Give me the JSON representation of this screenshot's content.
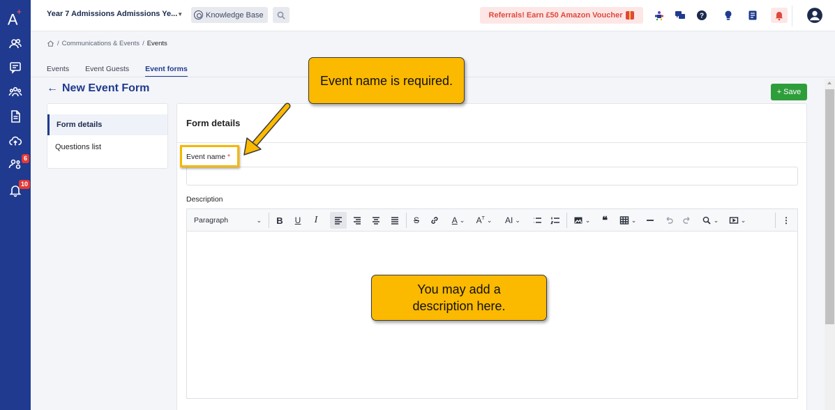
{
  "app": {
    "logo_text": "A",
    "logo_mark": "+"
  },
  "rail": {
    "items": [
      {
        "icon": "people-icon"
      },
      {
        "icon": "chat-icon"
      },
      {
        "icon": "group-icon"
      },
      {
        "icon": "document-icon"
      },
      {
        "icon": "cloud-upload-icon"
      },
      {
        "icon": "user-settings-icon",
        "badge": "6"
      },
      {
        "icon": "bell-icon",
        "badge": "10"
      }
    ]
  },
  "topbar": {
    "school_name": "Year 7 Admissions Admissions Ye...",
    "knowledge_base": "Knowledge Base",
    "referral": "Referrals! Earn £50 Amazon Voucher",
    "icons": [
      "community-icon",
      "messages-icon",
      "help-icon",
      "lightbulb-icon",
      "notes-icon",
      "bell-alert-icon",
      "user-avatar-icon"
    ]
  },
  "breadcrumb": {
    "items": [
      "Communications & Events",
      "Events"
    ],
    "separator": "/"
  },
  "tabs": [
    {
      "label": "Events",
      "active": false
    },
    {
      "label": "Event Guests",
      "active": false
    },
    {
      "label": "Event forms",
      "active": true
    }
  ],
  "page": {
    "title": "New Event Form",
    "save_label": "Save"
  },
  "sidenav": {
    "items": [
      {
        "label": "Form details",
        "active": true
      },
      {
        "label": "Questions list",
        "active": false
      }
    ]
  },
  "form": {
    "title": "Form details",
    "event_name_label": "Event name",
    "required_mark": "*",
    "event_name_value": "",
    "description_label": "Description",
    "paragraph_style": "Paragraph"
  },
  "callouts": {
    "event_name": "Event name is required.",
    "description": "You may add a description here."
  },
  "colors": {
    "brand": "#1f3a8f",
    "save": "#2e9e3b",
    "callout": "#fbb900",
    "badge": "#e53935"
  }
}
